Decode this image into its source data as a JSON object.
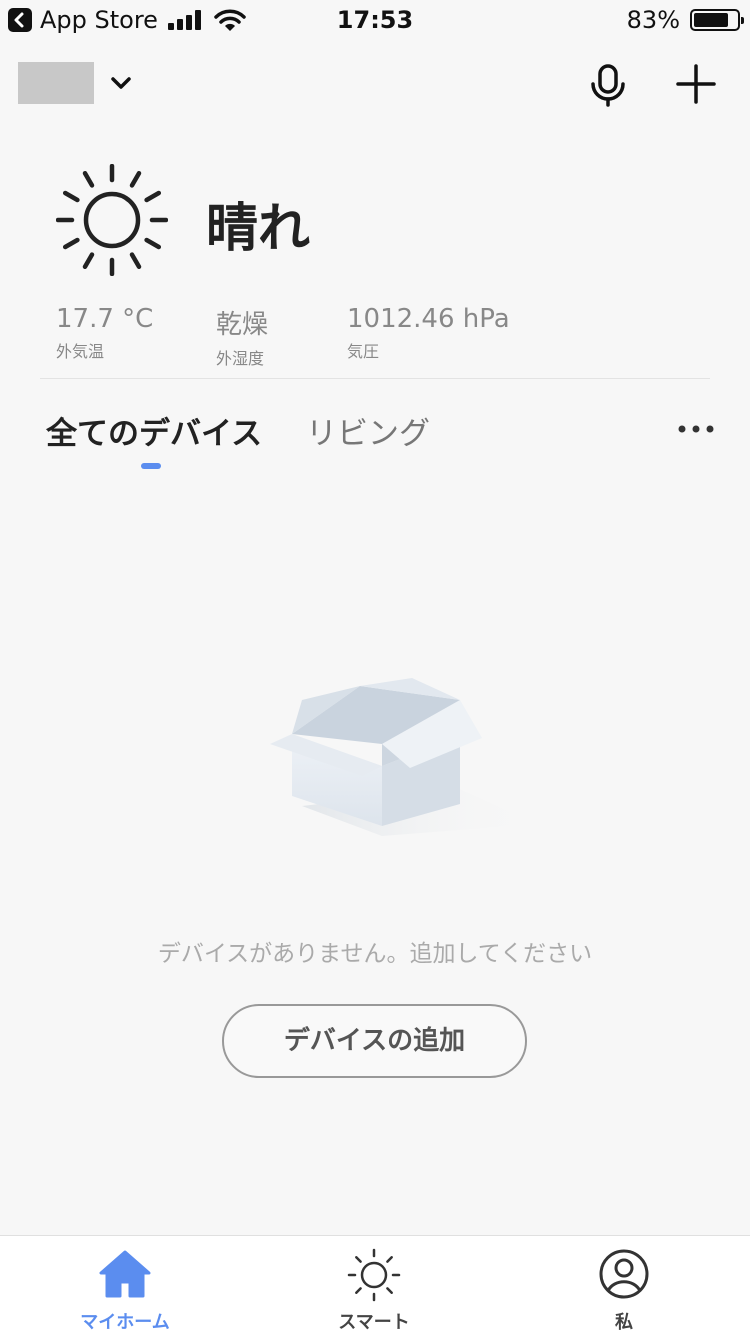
{
  "status_bar": {
    "carrier": "App Store",
    "time": "17:53",
    "battery_pct": "83%"
  },
  "header": {
    "home_dropdown_icon": "chevron-down-icon",
    "mic_icon": "microphone-icon",
    "add_icon": "plus-icon"
  },
  "weather": {
    "icon": "sun-icon",
    "condition": "晴れ",
    "stats": [
      {
        "value": "17.7 °C",
        "label": "外気温"
      },
      {
        "value": "乾燥",
        "label": "外湿度"
      },
      {
        "value": "1012.46 hPa",
        "label": "気圧"
      }
    ]
  },
  "tabs": {
    "active": "全てのデバイス",
    "inactive": "リビング",
    "more_icon": "more-horizontal-icon"
  },
  "empty_state": {
    "message": "デバイスがありません。追加してください",
    "button": "デバイスの追加",
    "illustration": "empty-box-icon"
  },
  "bottom_nav": {
    "items": [
      {
        "label": "マイホーム",
        "icon": "home-icon",
        "active": true
      },
      {
        "label": "スマート",
        "icon": "sun-icon",
        "active": false
      },
      {
        "label": "私",
        "icon": "user-icon",
        "active": false
      }
    ]
  },
  "colors": {
    "accent": "#5b8def",
    "background": "#f7f7f7"
  }
}
